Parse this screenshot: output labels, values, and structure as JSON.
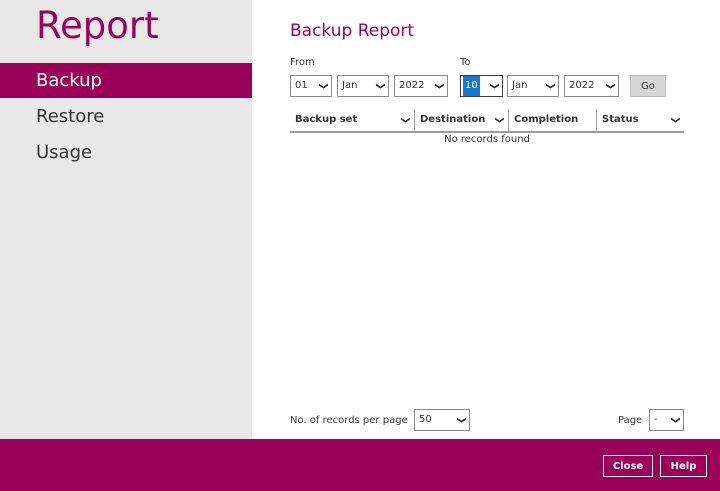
{
  "sidebar": {
    "title": "Report",
    "items": [
      {
        "label": "Backup",
        "active": true
      },
      {
        "label": "Restore",
        "active": false
      },
      {
        "label": "Usage",
        "active": false
      }
    ]
  },
  "main": {
    "title": "Backup Report",
    "from": {
      "label": "From",
      "day": "01",
      "month": "Jan",
      "year": "2022"
    },
    "to": {
      "label": "To",
      "day": "10",
      "month": "Jan",
      "year": "2022"
    },
    "go_label": "Go",
    "table": {
      "columns": [
        "Backup set",
        "Destination",
        "Completion",
        "Status"
      ],
      "empty_text": "No records found"
    },
    "records_per_page": {
      "label": "No. of records per page",
      "value": "50"
    },
    "page": {
      "label": "Page",
      "value": "-"
    }
  },
  "footer": {
    "close_label": "Close",
    "help_label": "Help"
  },
  "icons": {
    "dropdown": "chevron-down-icon"
  },
  "colors": {
    "accent": "#9b0058",
    "sidebar_bg": "#e8e8e8",
    "selected": "#1478d7"
  }
}
